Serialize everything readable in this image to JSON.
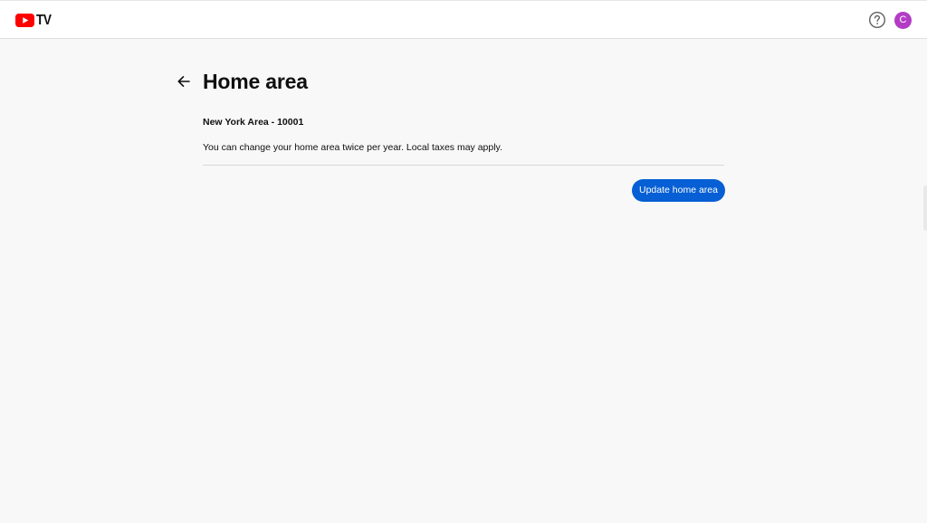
{
  "app": {
    "logo_text": "TV",
    "brand_color": "#ff0000",
    "icon": "youtube-play-icon"
  },
  "header": {
    "help_icon": "help-circle-icon",
    "avatar_initial": "C",
    "avatar_color": "#b23cc4"
  },
  "page": {
    "back_icon": "arrow-left-icon",
    "title": "Home area",
    "area_name": "New York Area - 10001",
    "info_text": "You can change your home area twice per year. Local taxes may apply.",
    "update_button_label": "Update home area",
    "accent_color": "#065fd4"
  }
}
